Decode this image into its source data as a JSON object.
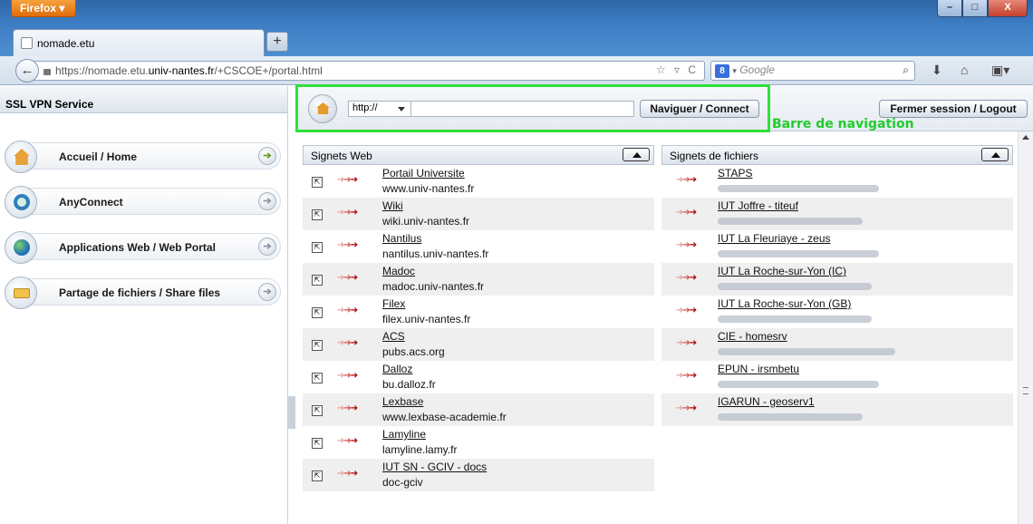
{
  "browser": {
    "app_button": "Firefox ▾",
    "tab_title": "nomade.etu",
    "new_tab": "+",
    "back_glyph": "←",
    "url_prefix": "https://nomade.etu.",
    "url_host": "univ-nantes.fr",
    "url_path": "/+CSCOE+/portal.html",
    "url_icons": "☆ ▿ C",
    "search_placeholder": "Google",
    "search_engine_badge": "8",
    "window_controls": [
      "–",
      "□",
      "X"
    ]
  },
  "sidebar": {
    "title": "SSL VPN Service",
    "items": [
      {
        "label": "Accueil / Home",
        "icon": "home-icon",
        "arrow_active": true
      },
      {
        "label": "AnyConnect",
        "icon": "anyconnect-icon",
        "arrow_active": false
      },
      {
        "label": "Applications Web / Web Portal",
        "icon": "globe-icon",
        "arrow_active": false
      },
      {
        "label": "Partage de fichiers / Share files",
        "icon": "folder-network-icon",
        "arrow_active": false
      }
    ]
  },
  "toolbar": {
    "protocol": "http://",
    "url_value": "",
    "navigate_label": "Naviguer / Connect",
    "logout_label": "Fermer session / Logout",
    "annotation": "Barre de navigation"
  },
  "web_bookmarks": {
    "header": "Signets Web",
    "items": [
      {
        "title": "Portail Universite",
        "url": "www.univ-nantes.fr"
      },
      {
        "title": "Wiki",
        "url": "wiki.univ-nantes.fr"
      },
      {
        "title": "Nantilus",
        "url": "nantilus.univ-nantes.fr"
      },
      {
        "title": "Madoc",
        "url": "madoc.univ-nantes.fr"
      },
      {
        "title": "Filex",
        "url": "filex.univ-nantes.fr"
      },
      {
        "title": "ACS",
        "url": "pubs.acs.org"
      },
      {
        "title": "Dalloz",
        "url": "bu.dalloz.fr"
      },
      {
        "title": "Lexbase",
        "url": "www.lexbase-academie.fr"
      },
      {
        "title": "Lamyline",
        "url": "lamyline.lamy.fr"
      },
      {
        "title": "IUT SN - GCIV - docs",
        "url": "doc-gciv"
      }
    ]
  },
  "file_bookmarks": {
    "header": "Signets de fichiers",
    "items": [
      {
        "title": "STAPS"
      },
      {
        "title": "IUT Joffre - titeuf"
      },
      {
        "title": "IUT La Fleuriaye - zeus"
      },
      {
        "title": "IUT La Roche-sur-Yon (IC)"
      },
      {
        "title": "IUT La Roche-sur-Yon (GB)"
      },
      {
        "title": "CIE - homesrv"
      },
      {
        "title": "EPUN - irsmbetu"
      },
      {
        "title": "IGARUN - geoserv1"
      }
    ]
  },
  "colors": {
    "highlight": "#2ee03b",
    "titlebar": "#3d7dc4",
    "firefox_button": "#e57a14"
  }
}
